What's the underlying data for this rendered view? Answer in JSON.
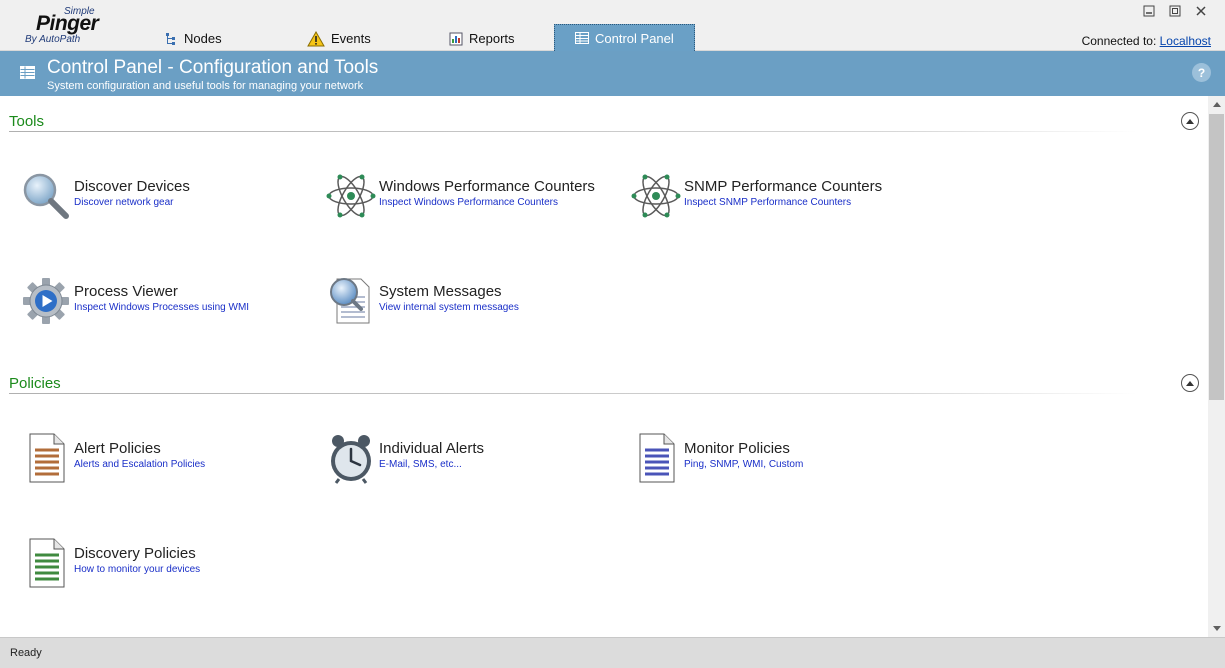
{
  "app": {
    "logo_small": "Simple",
    "logo_main": "Pinger",
    "logo_by": "By AutoPath"
  },
  "tabs": [
    {
      "label": "Nodes",
      "icon": "nodes-tree-icon"
    },
    {
      "label": "Events",
      "icon": "warning-icon"
    },
    {
      "label": "Reports",
      "icon": "reports-icon"
    },
    {
      "label": "Control Panel",
      "icon": "control-panel-icon",
      "active": true
    }
  ],
  "connection": {
    "label": "Connected to:",
    "host": "Localhost"
  },
  "window_controls": [
    "minimize",
    "restore",
    "close"
  ],
  "header": {
    "title": "Control Panel - Configuration and Tools",
    "subtitle": "System configuration and useful tools for managing your network",
    "help": "?"
  },
  "sections": {
    "tools": {
      "title": "Tools",
      "items": [
        {
          "name": "Discover Devices",
          "desc": "Discover network gear",
          "icon": "magnifier-icon"
        },
        {
          "name": "Windows Performance Counters",
          "desc": "Inspect Windows Performance Counters",
          "icon": "atom-icon"
        },
        {
          "name": "SNMP Performance Counters",
          "desc": "Inspect SNMP Performance Counters",
          "icon": "atom-icon"
        },
        {
          "name": "Process Viewer",
          "desc": "Inspect Windows Processes using WMI",
          "icon": "gear-play-icon"
        },
        {
          "name": "System Messages",
          "desc": "View internal system messages",
          "icon": "document-search-icon"
        }
      ]
    },
    "policies": {
      "title": "Policies",
      "items": [
        {
          "name": "Alert Policies",
          "desc": "Alerts and Escalation Policies",
          "icon": "document-icon",
          "color": "#b26d3a"
        },
        {
          "name": "Individual Alerts",
          "desc": "E-Mail, SMS, etc...",
          "icon": "alarm-clock-icon"
        },
        {
          "name": "Monitor Policies",
          "desc": "Ping, SNMP, WMI, Custom",
          "icon": "document-icon",
          "color": "#4a54b8"
        },
        {
          "name": "Discovery Policies",
          "desc": "How to monitor your devices",
          "icon": "document-icon",
          "color": "#3f8a3f"
        }
      ]
    }
  },
  "status": {
    "text": "Ready"
  },
  "colors": {
    "header_bg": "#6b9fc4",
    "section_title": "#1b8a1b",
    "link": "#1a2fc8"
  }
}
